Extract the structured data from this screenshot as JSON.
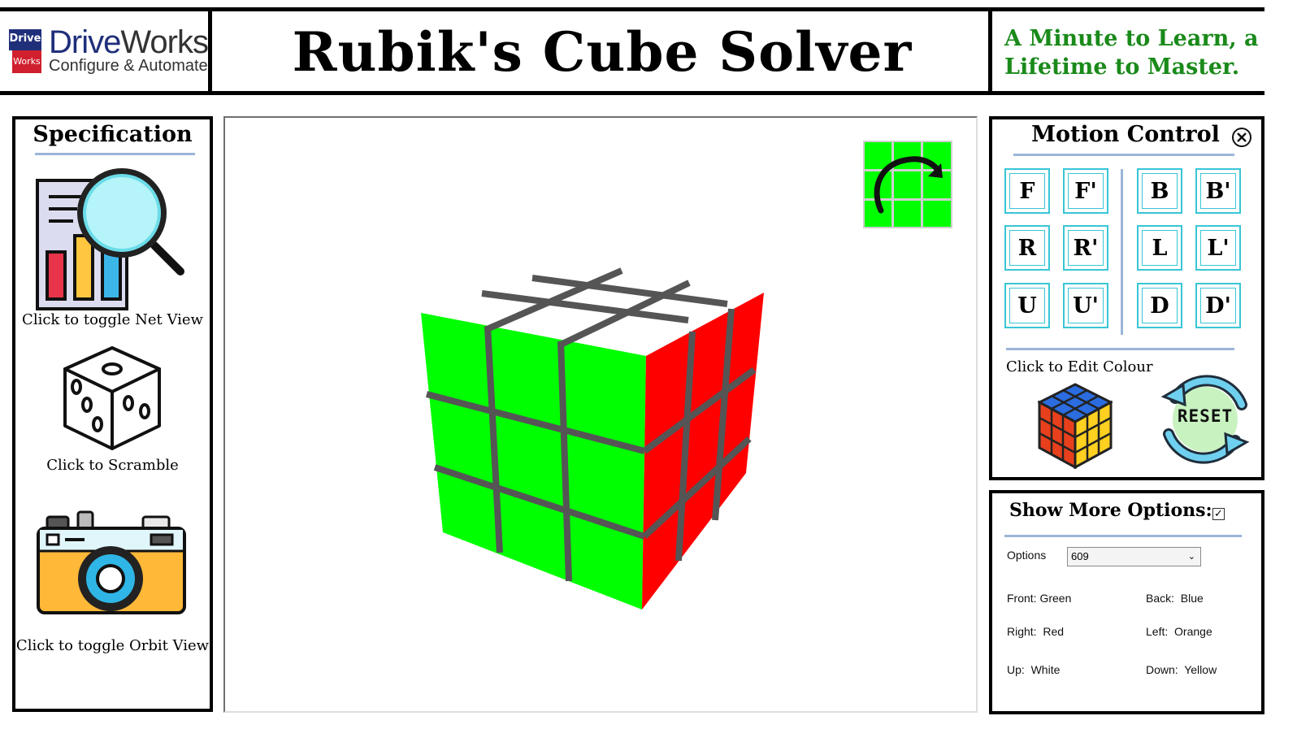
{
  "header": {
    "logo": {
      "mark_top": "Drive",
      "mark_bottom": "Works",
      "word_a": "Drive",
      "word_b": "Works",
      "tagline": "Configure & Automate"
    },
    "title": "Rubik's Cube Solver",
    "tagline": "A Minute to Learn, a Lifetime to Master."
  },
  "specification": {
    "title": "Specification",
    "net_view_label": "Click to toggle Net View",
    "scramble_label": "Click to Scramble",
    "orbit_view_label": "Click to toggle Orbit View"
  },
  "motion_control": {
    "title": "Motion Control",
    "buttons": [
      "F",
      "F'",
      "B",
      "B'",
      "R",
      "R'",
      "L",
      "L'",
      "U",
      "U'",
      "D",
      "D'"
    ],
    "edit_colour_label": "Click to Edit Colour",
    "reset_label": "RESET"
  },
  "more_options": {
    "title": "Show More Options:",
    "checked": true,
    "options_label": "Options",
    "options_value": "609",
    "faces": [
      {
        "label": "Front:",
        "value": "Green"
      },
      {
        "label": "Back:",
        "value": "Blue"
      },
      {
        "label": "Right:",
        "value": "Red"
      },
      {
        "label": "Left:",
        "value": "Orange"
      },
      {
        "label": "Up:",
        "value": "White"
      },
      {
        "label": "Down:",
        "value": "Yellow"
      }
    ]
  },
  "colors": {
    "front": "#00ff00",
    "right": "#ff0000",
    "up": "#ffffff",
    "accent_green": "#1a8a1a",
    "button_border": "#38c6d6",
    "divider_blue": "#9bb5d8"
  },
  "icons": {
    "net_view": "magnifier-chart-icon",
    "scramble": "dice-icon",
    "orbit_view": "camera-icon",
    "rotate_view": "rotate-arrow-icon",
    "edit_colour": "rubiks-cube-icon",
    "reset": "reset-arrows-icon",
    "close": "close-circle-icon"
  }
}
